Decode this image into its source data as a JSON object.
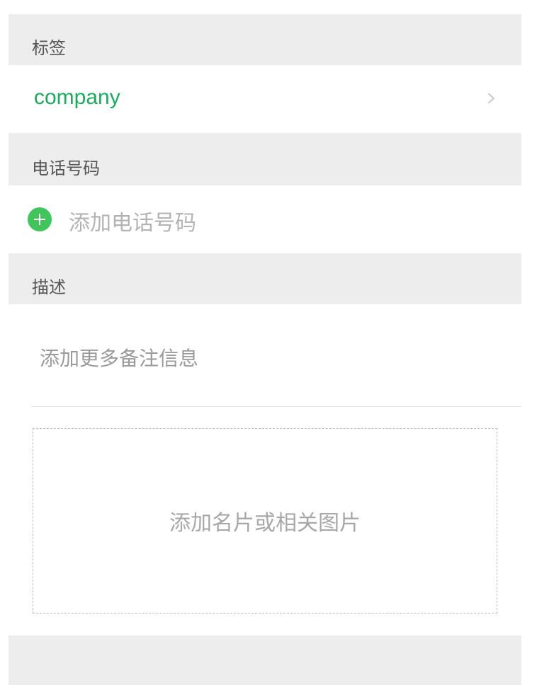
{
  "sections": {
    "tag": {
      "header": "标签",
      "value": "company"
    },
    "phone": {
      "header": "电话号码",
      "add_placeholder": "添加电话号码"
    },
    "description": {
      "header": "描述",
      "placeholder": "添加更多备注信息"
    },
    "image": {
      "label": "添加名片或相关图片"
    }
  },
  "colors": {
    "accent_green": "#1aad5b",
    "add_button_green": "#3fc55a",
    "section_bg": "#ededed"
  },
  "icons": {
    "tag_row": "chevron-right-icon",
    "phone_row": "add-circle-icon"
  }
}
